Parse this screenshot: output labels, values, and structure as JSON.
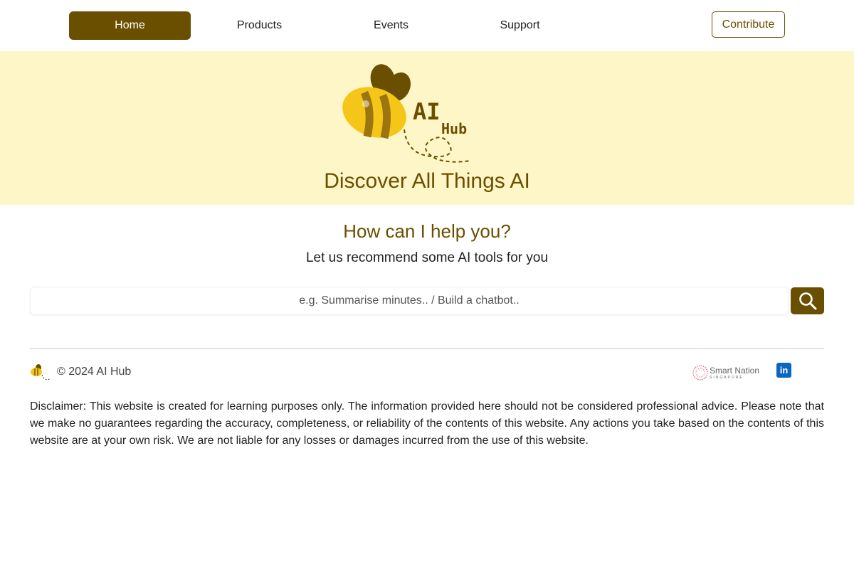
{
  "nav": {
    "items": [
      {
        "label": "Home",
        "active": true
      },
      {
        "label": "Products",
        "active": false
      },
      {
        "label": "Events",
        "active": false
      },
      {
        "label": "Support",
        "active": false
      }
    ],
    "contribute_label": "Contribute"
  },
  "hero": {
    "logo_text_main": "AI",
    "logo_text_sub": "Hub",
    "title": "Discover All Things AI"
  },
  "help": {
    "title": "How can I help you?",
    "subtitle": "Let us recommend some AI tools for you"
  },
  "search": {
    "placeholder": "e.g. Summarise minutes.. / Build a chatbot..",
    "value": "",
    "button_icon": "search-icon"
  },
  "footer": {
    "copyright": "© 2024 AI Hub",
    "partner_name": "Smart Nation",
    "partner_sub": "SINGAPORE",
    "social_icon": "linkedin-icon",
    "social_glyph": "in",
    "disclaimer": "Disclaimer: This website is created for learning purposes only. The information provided here should not be considered professional advice. Please note that we make no guarantees regarding the accuracy, completeness, or reliability of the contents of this website. Any actions you take based on the contents of this website are at your own risk. We are not liable for any losses or damages incurred from the use of this website."
  },
  "colors": {
    "brand": "#6b4f00",
    "hero_bg": "#fff6c7",
    "linkedin": "#0a66c2"
  }
}
